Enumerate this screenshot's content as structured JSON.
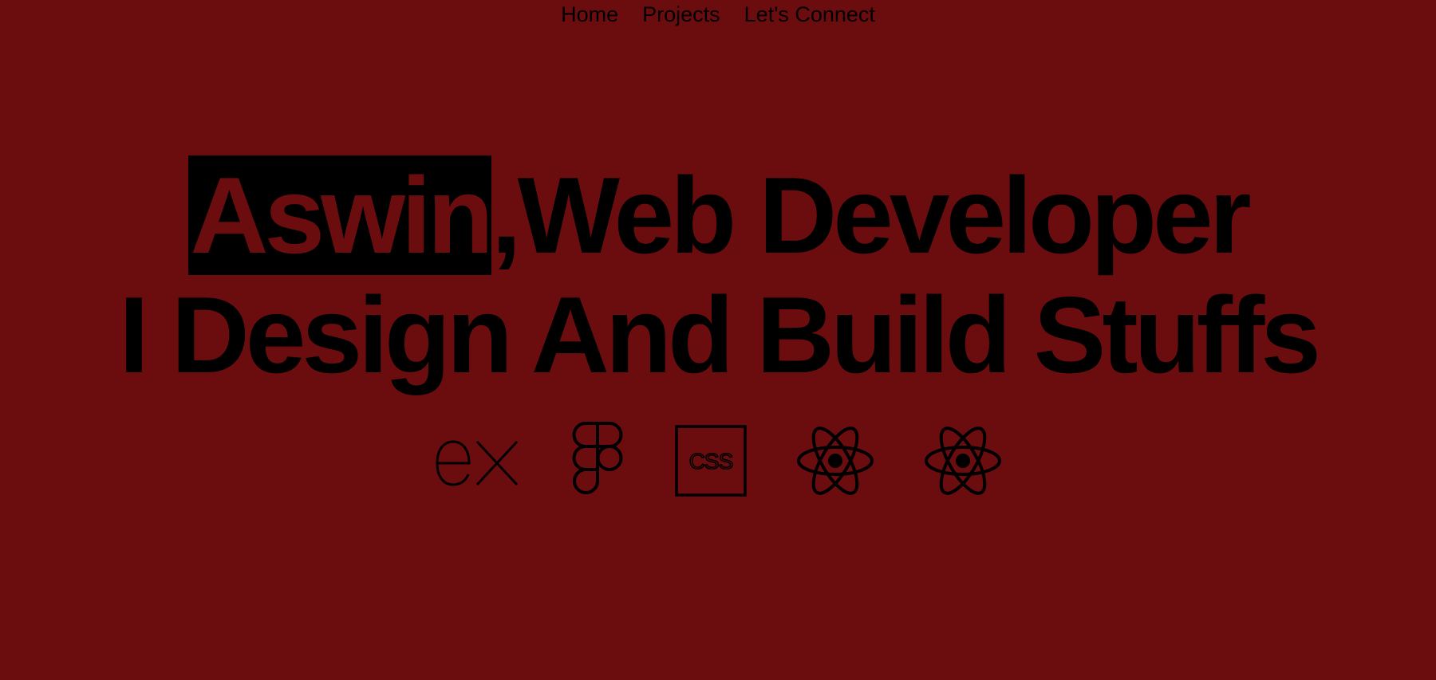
{
  "nav": {
    "items": [
      {
        "label": "Home"
      },
      {
        "label": "Projects"
      },
      {
        "label": "Let's Connect"
      }
    ]
  },
  "hero": {
    "name": "Aswin",
    "comma": ",",
    "role": "Web Developer",
    "tagline": "I Design And Build Stuffs"
  },
  "skills": {
    "icons": [
      "express-icon",
      "figma-icon",
      "css-icon",
      "react-icon",
      "react-icon"
    ],
    "css_text": "CSS"
  },
  "colors": {
    "background": "#6b0d0f",
    "foreground": "#000000"
  }
}
